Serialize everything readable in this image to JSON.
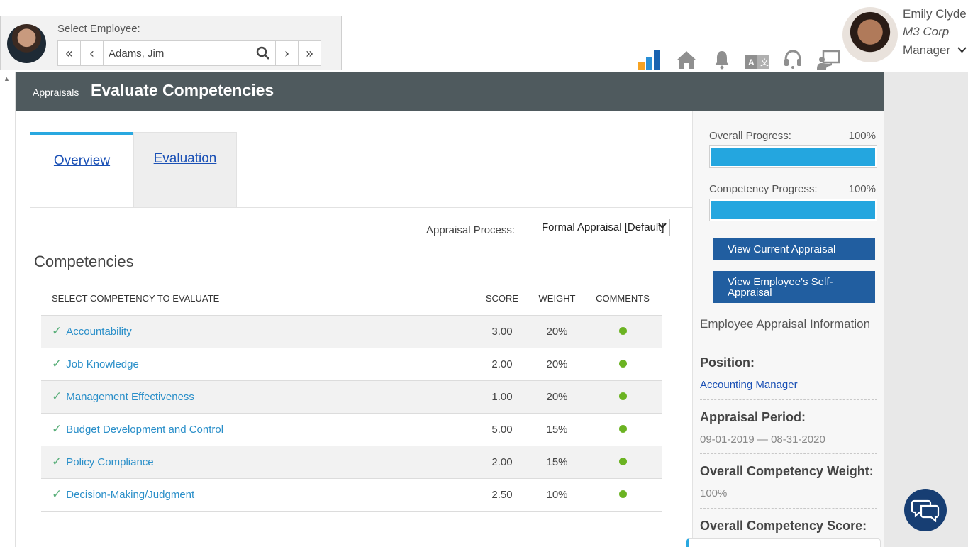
{
  "employee_selector": {
    "label": "Select Employee:",
    "value": "Adams, Jim",
    "nav_first": "«",
    "nav_prev": "‹",
    "nav_next": "›",
    "nav_last": "»"
  },
  "top_icons": [
    "bar-chart-icon",
    "home-icon",
    "bell-icon",
    "translate-icon",
    "headset-icon",
    "presentation-icon"
  ],
  "user": {
    "name": "Emily Clyde",
    "company": "M3 Corp",
    "role": "Manager"
  },
  "header": {
    "breadcrumb": "Appraisals",
    "title": "Evaluate Competencies"
  },
  "tabs": [
    {
      "label": "Overview",
      "active": true
    },
    {
      "label": "Evaluation",
      "active": false
    }
  ],
  "appraisal_process": {
    "label": "Appraisal Process:",
    "selected": "Formal Appraisal [Default]"
  },
  "competencies": {
    "title": "Competencies",
    "columns": [
      "SELECT COMPETENCY TO EVALUATE",
      "SCORE",
      "WEIGHT",
      "COMMENTS"
    ],
    "rows": [
      {
        "name": "Accountability",
        "score": "3.00",
        "weight": "20%"
      },
      {
        "name": "Job Knowledge",
        "score": "2.00",
        "weight": "20%"
      },
      {
        "name": "Management Effectiveness",
        "score": "1.00",
        "weight": "20%"
      },
      {
        "name": "Budget Development and Control",
        "score": "5.00",
        "weight": "15%"
      },
      {
        "name": "Policy Compliance",
        "score": "2.00",
        "weight": "15%"
      },
      {
        "name": "Decision-Making/Judgment",
        "score": "2.50",
        "weight": "10%"
      }
    ]
  },
  "right_panel": {
    "overall_progress": {
      "label": "Overall Progress:",
      "value": "100%",
      "fraction": 1.0
    },
    "competency_progress": {
      "label": "Competency Progress:",
      "value": "100%",
      "fraction": 1.0
    },
    "btn_current": "View Current Appraisal",
    "btn_self": "View Employee's Self-Appraisal",
    "info_title": "Employee Appraisal Information",
    "position_label": "Position:",
    "position_value": "Accounting Manager",
    "period_label": "Appraisal Period:",
    "period_value": "09-01-2019 — 08-31-2020",
    "weight_label": "Overall Competency Weight:",
    "weight_value": "100%",
    "score_label": "Overall Competency Score:"
  },
  "colors": {
    "header_bg": "#4f5a5e",
    "accent": "#29a8e0",
    "button": "#215ea0",
    "link": "#2a8fc9",
    "comment_dot": "#6bb322"
  }
}
